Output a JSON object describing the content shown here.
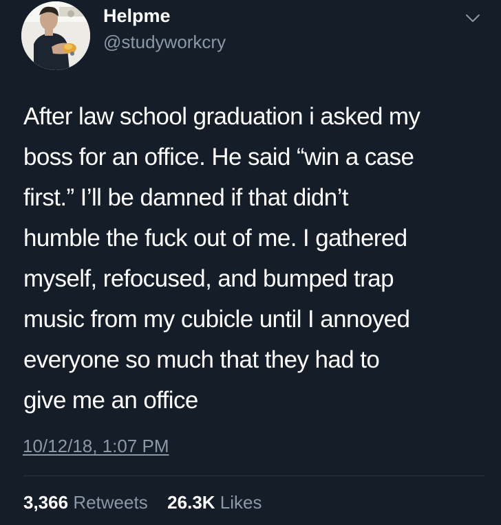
{
  "user": {
    "display_name": "Helpme",
    "handle": "@studyworkcry"
  },
  "tweet": {
    "lines": [
      "After law school graduation i asked my",
      "boss for an office. He said “win a case",
      "first.” I’ll be damned if that didn’t",
      "humble the fuck out of me. I gathered",
      "myself, refocused, and bumped trap",
      "music from my cubicle until I annoyed",
      "everyone so much that they had to",
      "give me an office"
    ],
    "timestamp": "10/12/18, 1:07 PM"
  },
  "stats": {
    "retweets_count": "3,366",
    "retweets_label": "Retweets",
    "likes_count": "26.3K",
    "likes_label": "Likes"
  },
  "icons": {
    "menu": "chevron-down-icon"
  },
  "colors": {
    "background": "#151d28",
    "text": "#ffffff",
    "secondary": "#8b98a5",
    "divider": "#2a3441"
  }
}
